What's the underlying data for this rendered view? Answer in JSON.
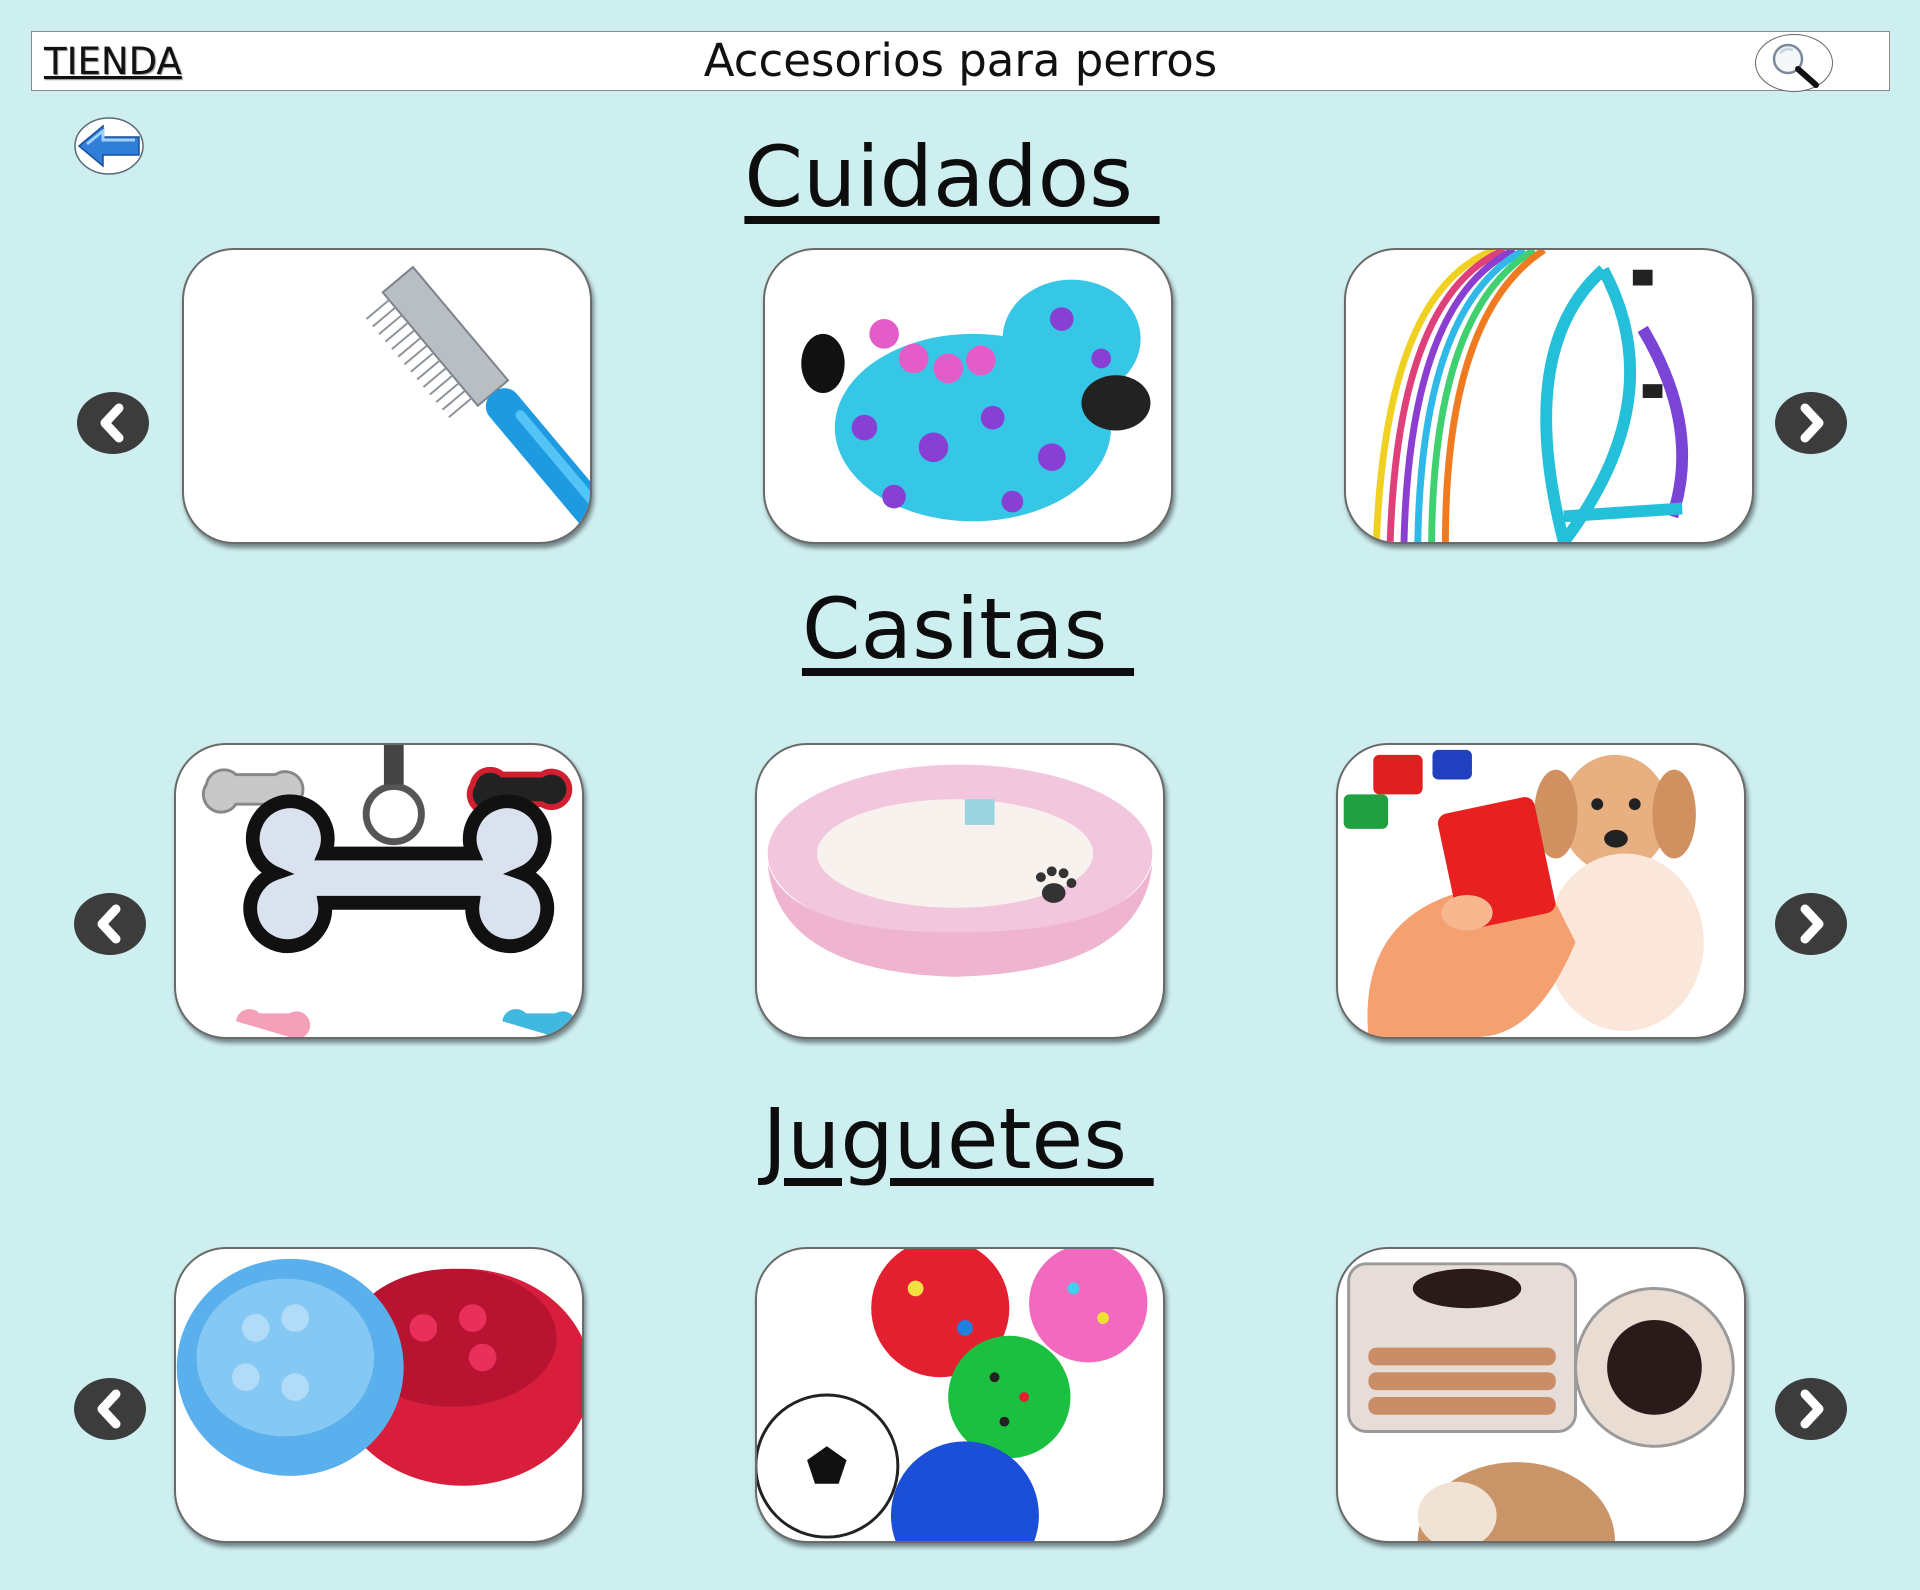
{
  "header": {
    "store_label": "TIENDA",
    "title": "Accesorios para perros",
    "search_icon": "magnifier-icon"
  },
  "back_icon": "arrow-left-icon",
  "sections": [
    {
      "title": "Cuidados ",
      "products": [
        "comb",
        "costume",
        "harness"
      ]
    },
    {
      "title": "Casitas ",
      "products": [
        "bone-id-tags",
        "pink-bed",
        "clicker-puppy"
      ]
    },
    {
      "title": "Juguetes ",
      "products": [
        "slow-feeder-bowls",
        "toy-balls",
        "dog-treats"
      ]
    }
  ],
  "nav_icons": {
    "prev": "chevron-left-icon",
    "next": "chevron-right-icon"
  },
  "colors": {
    "background": "#ceeff0",
    "card": "#ffffff",
    "nav_button": "#3c3c3c"
  }
}
